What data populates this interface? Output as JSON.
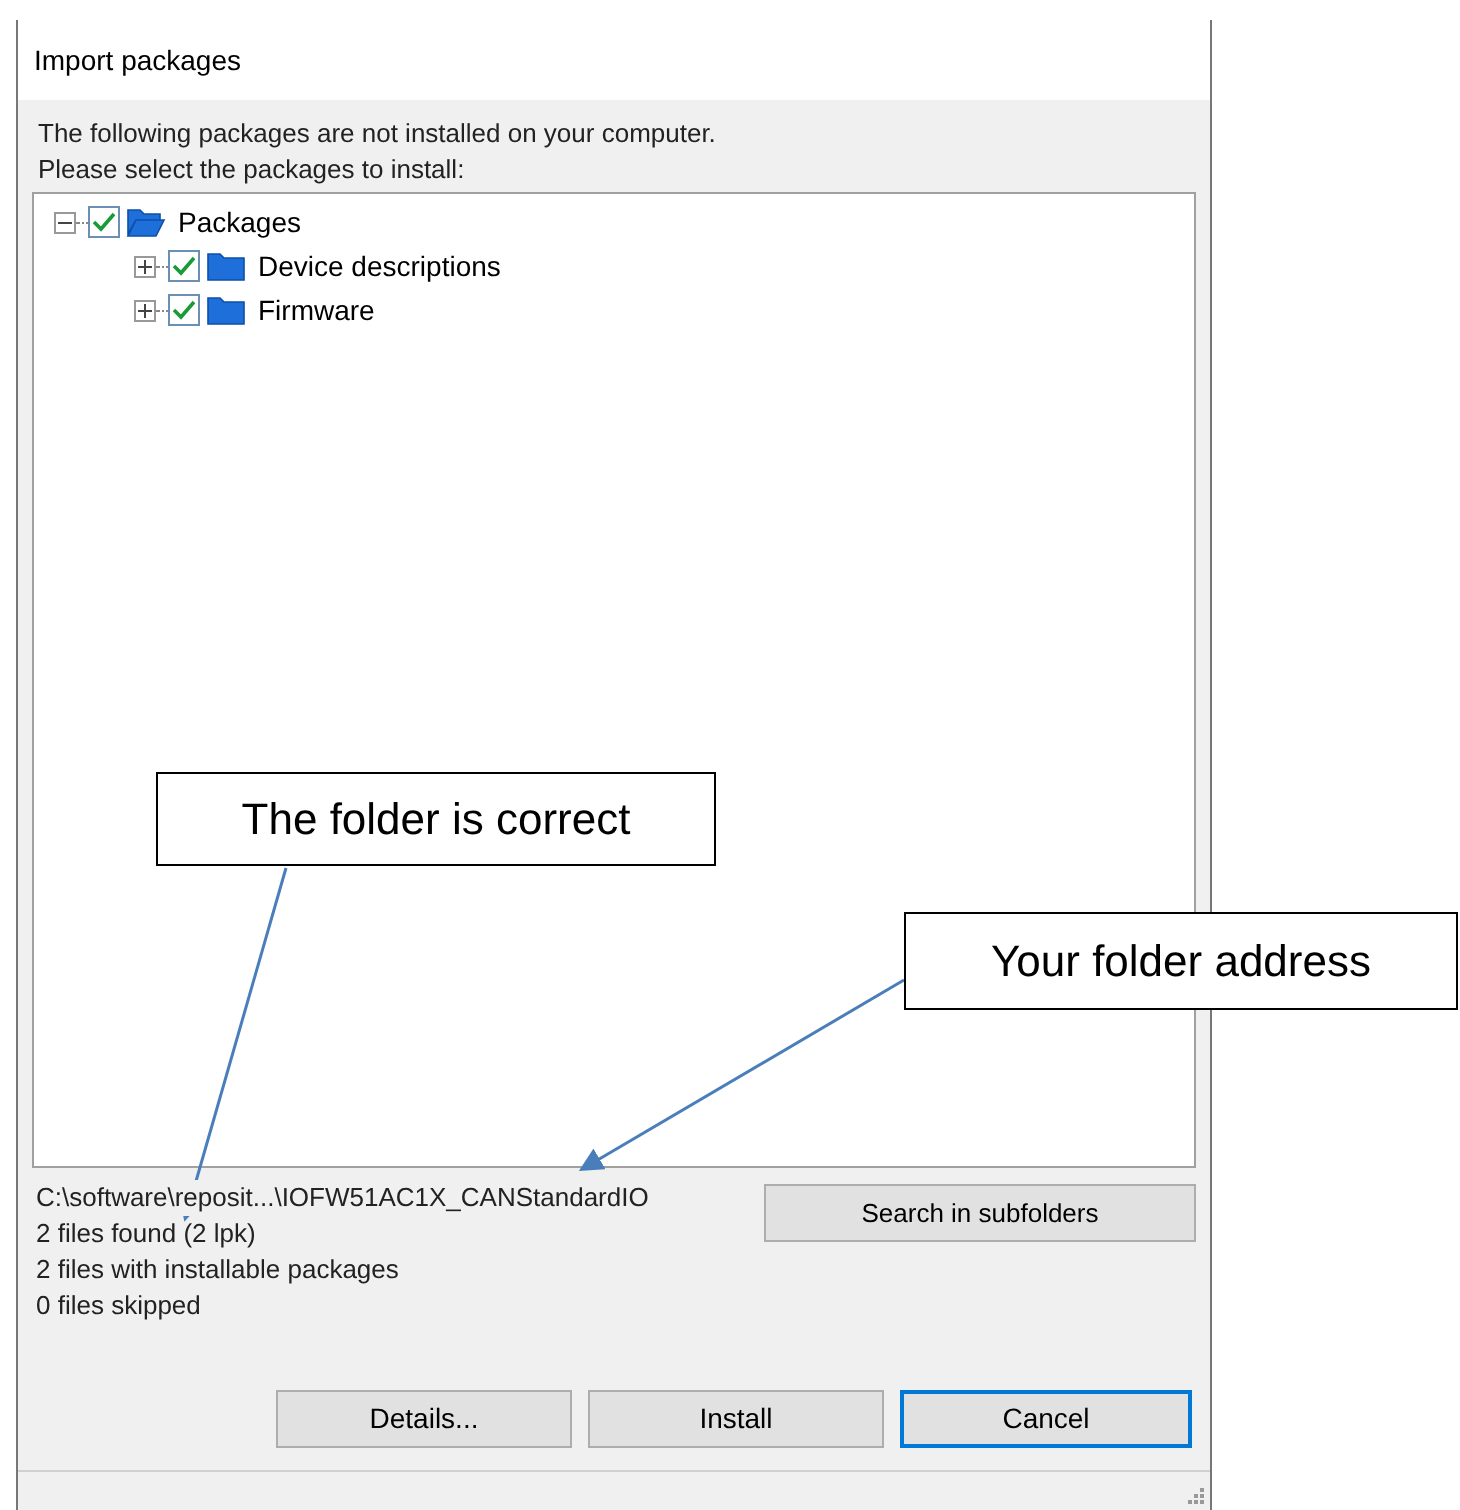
{
  "window": {
    "title": "Import packages"
  },
  "intro": [
    "The following packages are not installed on your computer.",
    "Please select the packages to install:"
  ],
  "tree": [
    {
      "label": "Packages",
      "checked": true,
      "expanded": true,
      "children": [
        {
          "label": "Device descriptions",
          "checked": true,
          "expanded": false
        },
        {
          "label": "Firmware",
          "checked": true,
          "expanded": false
        }
      ]
    }
  ],
  "path": "C:\\software\\reposit...\\IOFW51AC1X_CANStandardIO",
  "search_button": "Search in subfolders",
  "status_lines": [
    "2 files found (2 lpk)",
    "2 files with installable packages",
    "0 files skipped"
  ],
  "buttons": [
    {
      "label": "Details...",
      "selected": false
    },
    {
      "label": "Install",
      "selected": false
    },
    {
      "label": "Cancel",
      "selected": true
    }
  ],
  "callouts": [
    "The folder is correct",
    "Your folder address"
  ]
}
